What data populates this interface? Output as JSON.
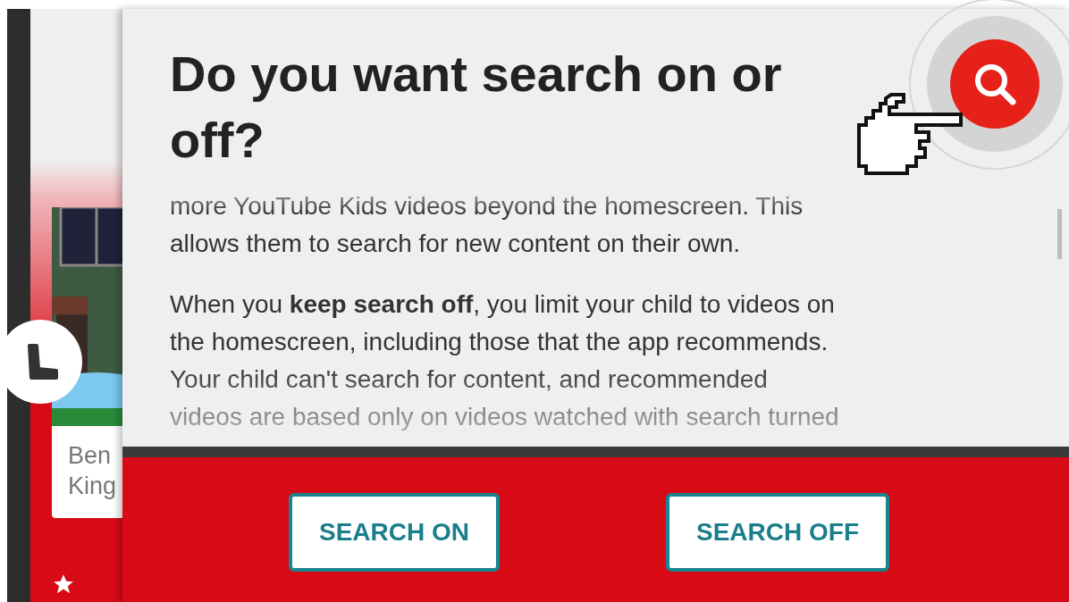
{
  "background_card": {
    "title": "Ben King"
  },
  "dialog": {
    "title": "Do you want search on or off?",
    "paragraphs": [
      {
        "lines": [
          "more YouTube Kids videos beyond the homescreen. This",
          "allows them to search for new content on their own."
        ]
      },
      {
        "lines": [
          "When you **keep search off**, you limit your child to videos on",
          "the homescreen, including those that the app recommends.",
          "Your child can't search for content, and recommended",
          "videos are based only on videos watched with search turned"
        ]
      }
    ],
    "buttons": [
      {
        "label": "SEARCH ON"
      },
      {
        "label": "SEARCH OFF"
      }
    ]
  }
}
